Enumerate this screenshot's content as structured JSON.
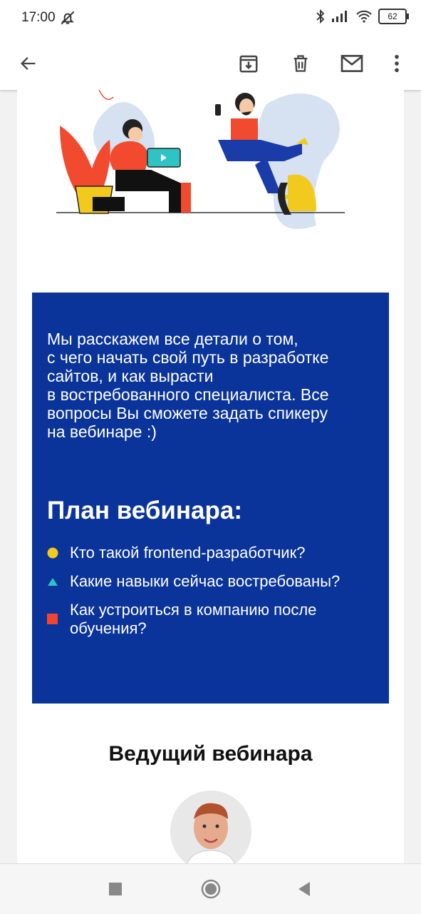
{
  "status": {
    "time": "17:00",
    "battery": "62"
  },
  "toolbar": {
    "back_icon": "arrow-back-icon",
    "archive_icon": "archive-icon",
    "delete_icon": "trash-icon",
    "mail_icon": "mail-icon",
    "more_icon": "more-vert-icon"
  },
  "email": {
    "intro": "Мы расскажем все детали о том,\nс чего начать свой путь в разработке\nсайтов, и как вырасти\nв востребованного специалиста. Все\nвопросы Вы сможете задать спикеру\nна вебинаре :)",
    "plan_title": "План вебинара:",
    "plan_items": [
      {
        "text": "Кто такой frontend-разработчик?",
        "marker": "circle",
        "color": "#f2c91d"
      },
      {
        "text": "Какие навыки сейчас востребованы?",
        "marker": "triangle",
        "color": "#2ec4c4"
      },
      {
        "text": "Как устроиться в компанию после обучения?",
        "marker": "square",
        "color": "#f2452f"
      }
    ],
    "host_title": "Ведущий вебинара"
  },
  "colors": {
    "accent_blue": "#0a349a"
  }
}
